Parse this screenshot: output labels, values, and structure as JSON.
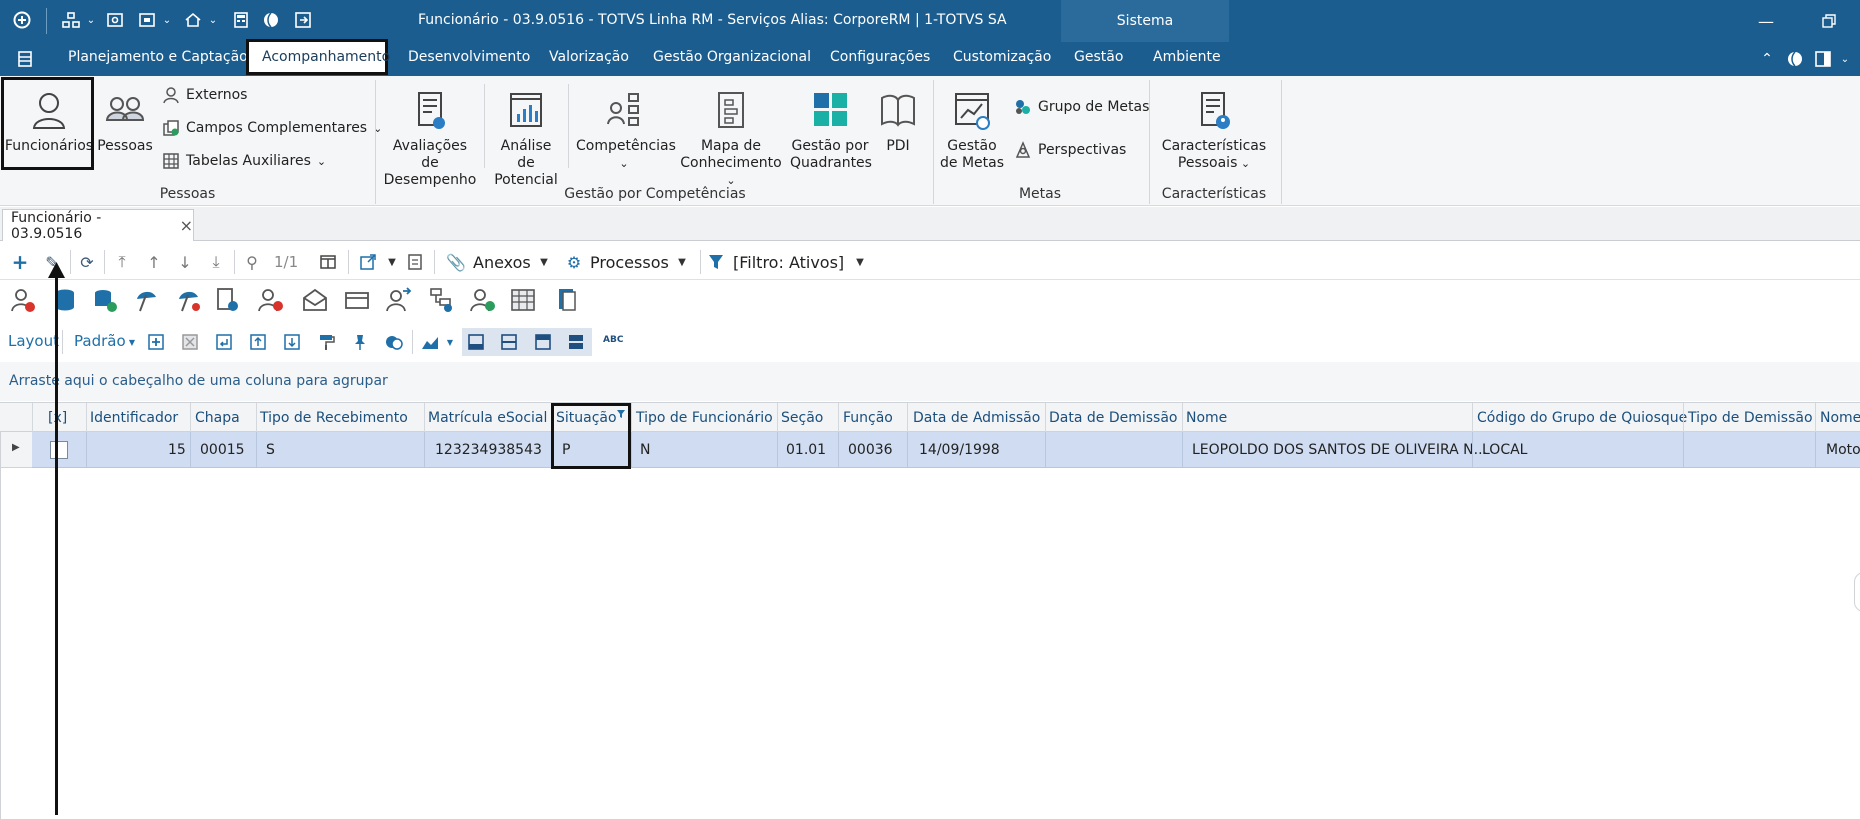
{
  "window": {
    "title": "Funcionário - 03.9.0516 - TOTVS Linha RM - Serviços  Alias: CorporeRM | 1-TOTVS SA",
    "sistema_tab": "Sistema"
  },
  "menu": {
    "items": [
      "Planejamento e Captação",
      "Acompanhamento",
      "Desenvolvimento",
      "Valorização",
      "Gestão Organizacional",
      "Configurações",
      "Customização",
      "Gestão",
      "Ambiente"
    ]
  },
  "ribbon": {
    "pessoas": {
      "funcionarios": "Funcionários",
      "pessoas": "Pessoas",
      "externos": "Externos",
      "campos_complementares": "Campos Complementares",
      "tabelas_auxiliares": "Tabelas Auxiliares",
      "group": "Pessoas"
    },
    "competencias": {
      "avaliacoes_1": "Avaliações de",
      "avaliacoes_2": "Desempenho",
      "analise_1": "Análise de",
      "analise_2": "Potencial",
      "competencias": "Competências",
      "mapa_1": "Mapa de",
      "mapa_2": "Conhecimento",
      "gestao_quad_1": "Gestão por",
      "gestao_quad_2": "Quadrantes",
      "pdi": "PDI",
      "group": "Gestão por Competências"
    },
    "metas": {
      "gestao_1": "Gestão",
      "gestao_2": "de Metas",
      "grupo_metas": "Grupo de Metas",
      "perspectivas": "Perspectivas",
      "group": "Metas"
    },
    "caracteristicas": {
      "label_1": "Características",
      "label_2": "Pessoais",
      "group": "Características"
    }
  },
  "doc_tab": {
    "label": "Funcionário - 03.9.0516",
    "close": "×"
  },
  "toolbar": {
    "page": "1/1",
    "anexos": "Anexos",
    "processos": "Processos",
    "filtro": "[Filtro: Ativos]",
    "layout": "Layout",
    "padrao": "Padrão",
    "abc": "ABC"
  },
  "group_hint": "Arraste aqui o cabeçalho de uma coluna para agrupar",
  "grid": {
    "columns": [
      "[x]",
      "Identificador",
      "Chapa",
      "Tipo de Recebimento",
      "Matrícula eSocial",
      "Situação",
      "Tipo de Funcionário",
      "Seção",
      "Função",
      "Data de Admissão",
      "Data de Demissão",
      "Nome",
      "Código do Grupo de Quiosque",
      "Tipo de Demissão",
      "Nome"
    ],
    "rows": [
      {
        "identificador": "15",
        "chapa": "00015",
        "tipo_recebimento": "S",
        "matricula": "123234938543",
        "situacao": "P",
        "tipo_funcionario": "N",
        "secao": "01.01",
        "funcao": "00036",
        "data_admissao": "14/09/1998",
        "data_demissao": "",
        "nome": "LEOPOLDO DOS SANTOS DE OLIVEIRA N...",
        "codigo_quiosque": "LOCAL",
        "tipo_demissao": "",
        "nome2": "Motor"
      }
    ]
  },
  "colors": {
    "titlebar": "#1b5d8f",
    "row_selected": "#cfdcf1",
    "link_blue": "#2a5d8a"
  }
}
